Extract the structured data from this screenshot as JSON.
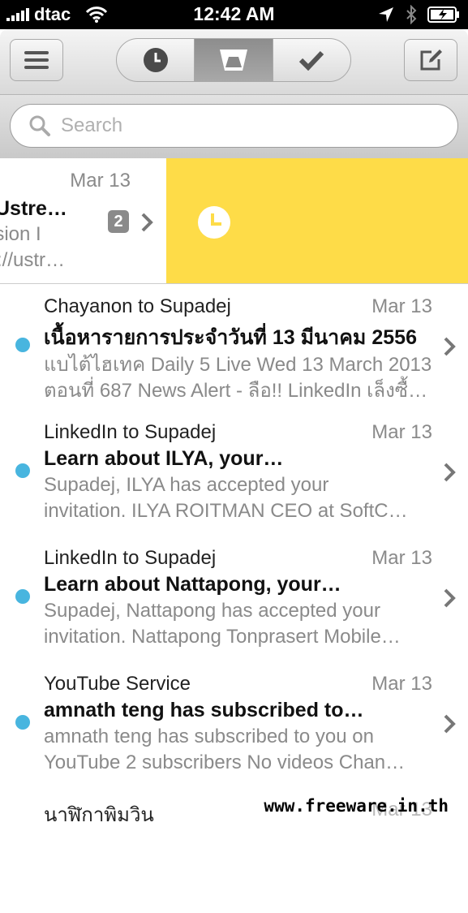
{
  "status_bar": {
    "carrier": "dtac",
    "time": "12:42 AM"
  },
  "search": {
    "placeholder": "Search"
  },
  "swiped_item": {
    "date": "Mar 13",
    "subject": "Ustre…",
    "preview_1": "ision I",
    "preview_2": "://ustr…",
    "count": "2"
  },
  "emails": [
    {
      "from": "Chayanon to Supadej",
      "date": "Mar 13",
      "subject": "เนื้อหารายการประจำวันที่ 13 มีนาคม 2556",
      "preview_1": "แบไต้ไฮเทค Daily 5 Live Wed 13 March 2013",
      "preview_2": "ตอนที่ 687 News Alert - ลือ!! LinkedIn เล็งซื้…"
    },
    {
      "from": "LinkedIn to Supadej",
      "date": "Mar 13",
      "subject": "Learn about ILYA, your…",
      "preview_1": "Supadej, ILYA has accepted your",
      "preview_2": "invitation. ILYA ROITMAN CEO at SoftC…"
    },
    {
      "from": "LinkedIn to Supadej",
      "date": "Mar 13",
      "subject": "Learn about Nattapong, your…",
      "preview_1": "Supadej, Nattapong has accepted your",
      "preview_2": "invitation. Nattapong Tonprasert Mobile…"
    },
    {
      "from": "YouTube Service",
      "date": "Mar 13",
      "subject": "amnath teng has subscribed to…",
      "preview_1": "amnath teng has subscribed to you on",
      "preview_2": "YouTube 2 subscribers No videos Chan…"
    },
    {
      "from": "นาฬิกาพิมวิน",
      "date": "Mar 13",
      "subject": "",
      "preview_1": "",
      "preview_2": ""
    }
  ],
  "watermark": "www.freeware.in.th",
  "colors": {
    "snooze_yellow": "#fedc48",
    "unread_dot": "#48b5df"
  },
  "icons": [
    "hamburger-menu-icon",
    "clock-icon",
    "inbox-tray-icon",
    "checkmark-icon",
    "compose-icon",
    "search-icon",
    "chevron-right-icon",
    "location-arrow-icon",
    "bluetooth-icon",
    "battery-icon",
    "wifi-icon"
  ]
}
